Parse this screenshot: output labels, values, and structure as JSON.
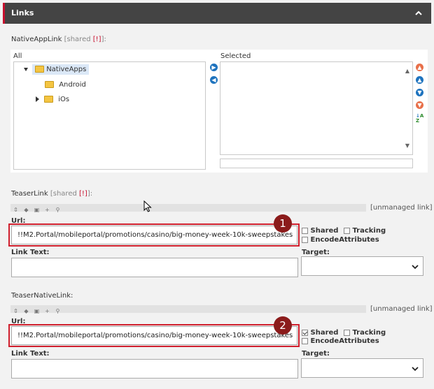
{
  "header": {
    "title": "Links"
  },
  "native_app_link": {
    "label": "NativeAppLink",
    "shared": "[shared ",
    "bang": "[!]",
    "shared_close": "]:",
    "all_label": "All",
    "selected_label": "Selected",
    "tree": [
      {
        "label": "NativeApps",
        "expanded": true
      },
      {
        "label": "Android"
      },
      {
        "label": "iOs",
        "expanded": false
      }
    ]
  },
  "teaser_link": {
    "label": "TeaserLink",
    "shared": "[shared ",
    "bang": "[!]",
    "shared_close": "]:",
    "unmanaged": "[unmanaged link]",
    "url_label": "Url:",
    "url_value": "!!M2.Portal/mobileportal/promotions/casino/big-money-week-10k-sweepstakes",
    "shared_chk": "Shared",
    "tracking_chk": "Tracking",
    "encode_chk": "EncodeAttributes",
    "link_text_label": "Link Text:",
    "target_label": "Target:",
    "callout_number": "1"
  },
  "teaser_native_link": {
    "label": "TeaserNativeLink:",
    "unmanaged": "[unmanaged link]",
    "url_label": "Url:",
    "url_value": "!!M2.Portal/mobileportal/promotions/casino/big-money-week-10k-sweepstakes",
    "shared_chk": "Shared",
    "tracking_chk": "Tracking",
    "encode_chk": "EncodeAttributes",
    "link_text_label": "Link Text:",
    "target_label": "Target:",
    "callout_number": "2"
  }
}
